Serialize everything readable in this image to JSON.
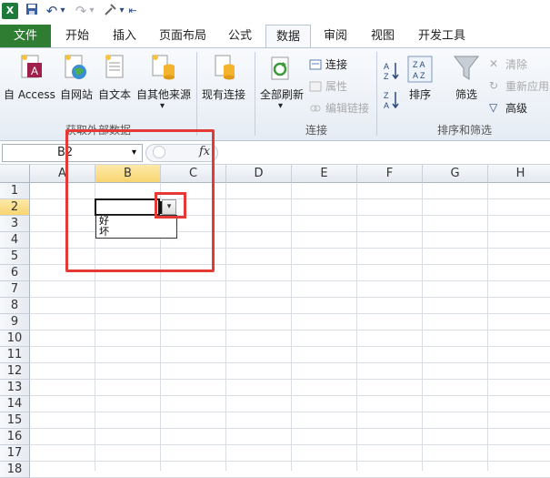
{
  "qat": {
    "dropdown_glyph": "▾",
    "customize_glyph": "⇤"
  },
  "tabs": [
    "文件",
    "开始",
    "插入",
    "页面布局",
    "公式",
    "数据",
    "审阅",
    "视图",
    "开发工具"
  ],
  "ribbon": {
    "get_external": {
      "access": "自 Access",
      "web": "自网站",
      "text": "自文本",
      "other": "自其他来源",
      "label": "获取外部数据"
    },
    "existing": "现有连接",
    "connections": {
      "refresh_all": "全部刷新",
      "connections": "连接",
      "properties": "属性",
      "edit_links": "编辑链接",
      "label": "连接"
    },
    "sort_filter": {
      "sort": "排序",
      "filter": "筛选",
      "clear": "清除",
      "reapply": "重新应用",
      "advanced": "高级",
      "label": "排序和筛选"
    }
  },
  "formula_bar": {
    "name_box": "B2",
    "fx": "fx"
  },
  "columns": [
    "A",
    "B",
    "C",
    "D",
    "E",
    "F",
    "G",
    "H"
  ],
  "rows": [
    "1",
    "2",
    "3",
    "4",
    "5",
    "6",
    "7",
    "8",
    "9",
    "10",
    "11",
    "12",
    "13",
    "14",
    "15",
    "16",
    "17",
    "18"
  ],
  "dropdown": {
    "options": [
      "好",
      "坏"
    ]
  },
  "colors": {
    "file_tab": "#2e7d32",
    "highlight_box": "#e53935",
    "header_highlight": "#f8d571"
  }
}
